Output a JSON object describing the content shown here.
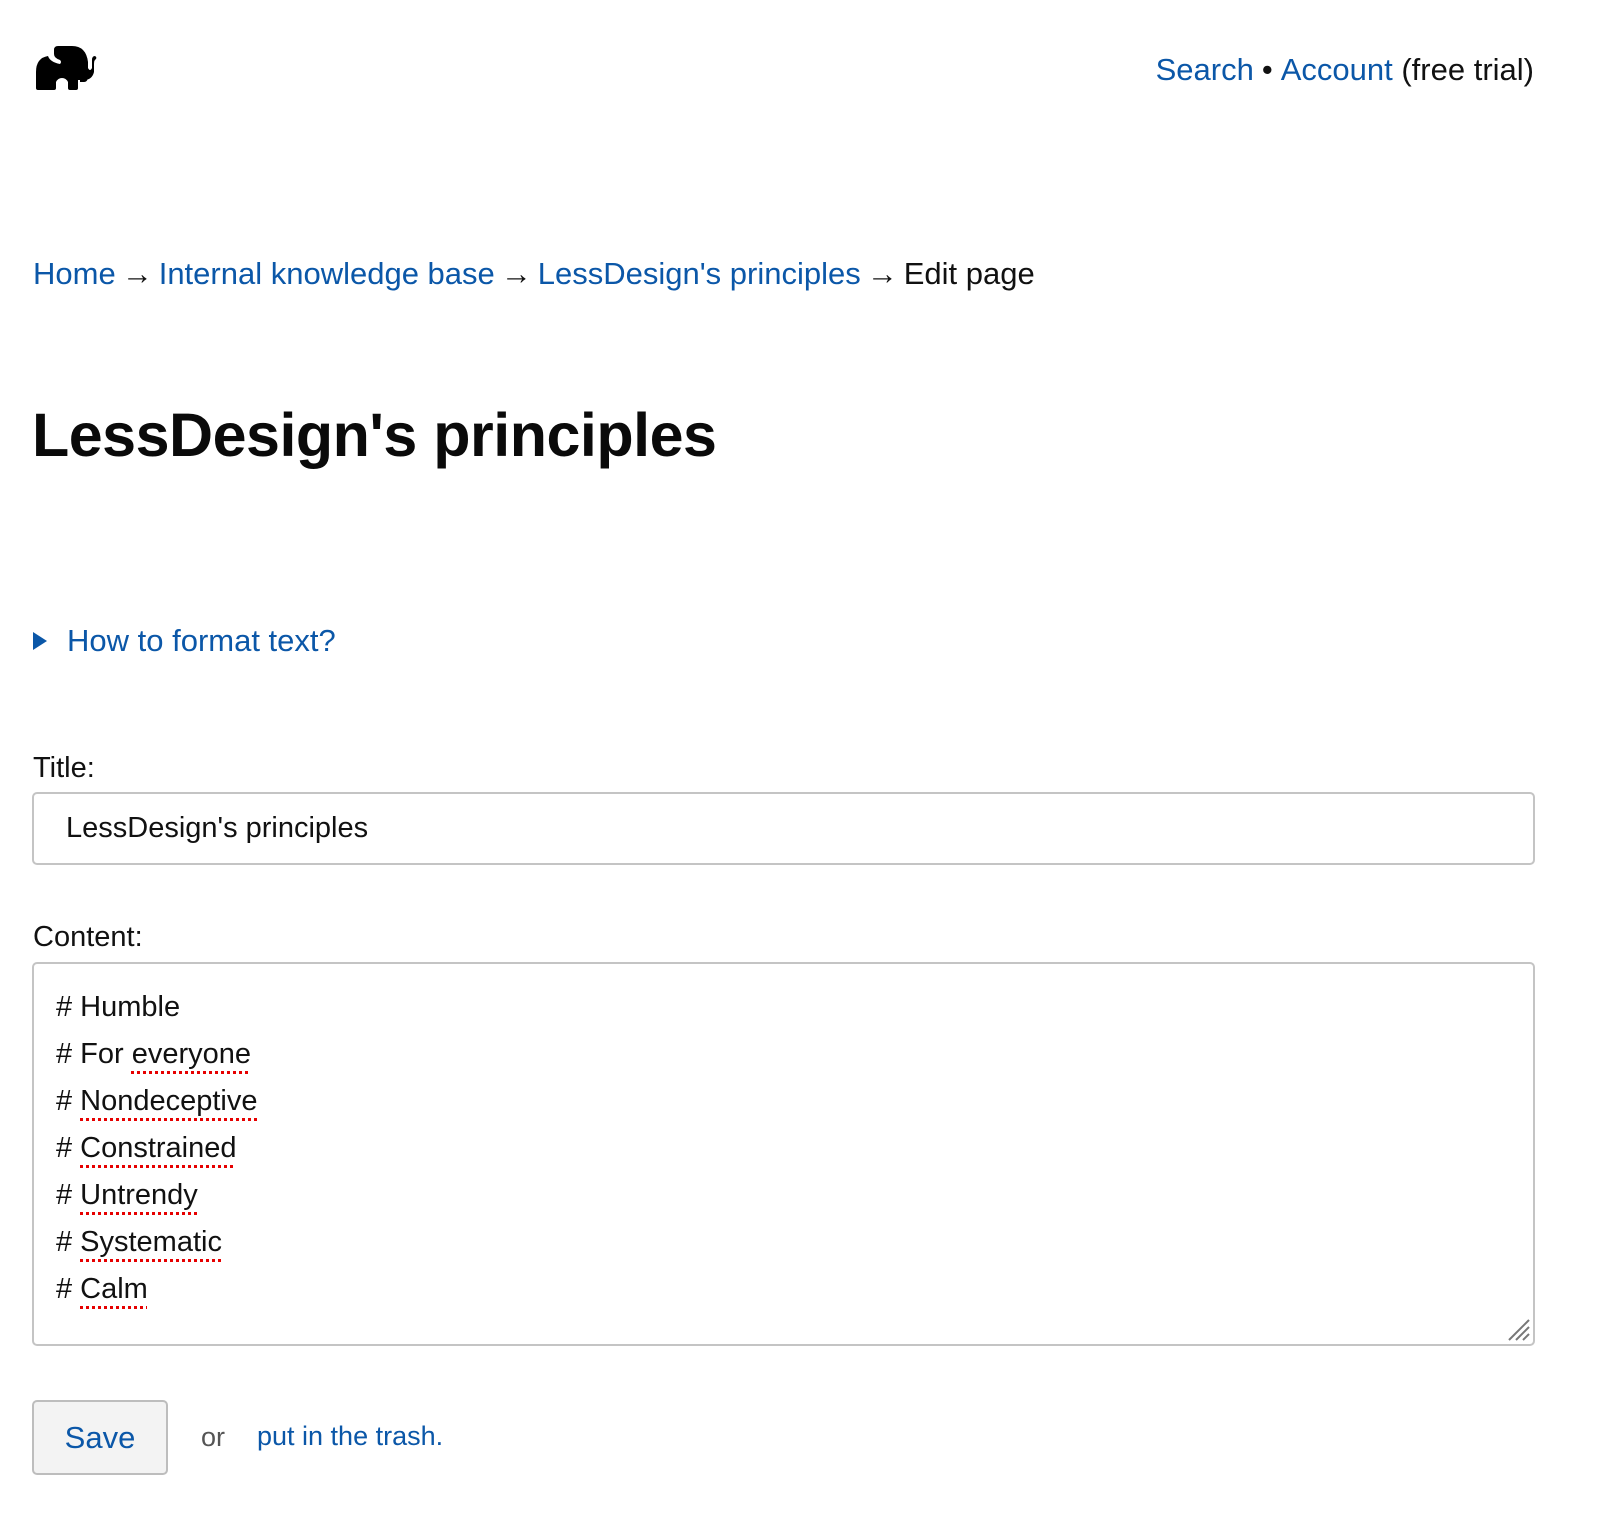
{
  "header": {
    "logo_icon": "elephant-icon",
    "nav": {
      "search_label": "Search",
      "separator": "•",
      "account_label": "Account",
      "account_note": "(free trial)"
    }
  },
  "breadcrumb": {
    "items": [
      {
        "label": "Home",
        "link": true
      },
      {
        "label": "Internal knowledge base",
        "link": true
      },
      {
        "label": "LessDesign's principles",
        "link": true
      },
      {
        "label": "Edit page",
        "link": false
      }
    ],
    "separator": "→"
  },
  "page": {
    "title": "LessDesign's principles",
    "format_help_label": "How to format text?"
  },
  "form": {
    "title_label": "Title:",
    "title_value": "LessDesign's principles",
    "content_label": "Content:",
    "content_lines": [
      {
        "hash": "#",
        "text": "Humble",
        "misspelled": false
      },
      {
        "hash": "#",
        "prefix": "For ",
        "text": "everyone",
        "misspelled": true
      },
      {
        "hash": "#",
        "text": "Nondeceptive",
        "misspelled": true
      },
      {
        "hash": "#",
        "text": "Constrained",
        "misspelled": true
      },
      {
        "hash": "#",
        "text": "Untrendy",
        "misspelled": true
      },
      {
        "hash": "#",
        "text": "Systematic",
        "misspelled": true
      },
      {
        "hash": "#",
        "text": "Calm",
        "misspelled": true
      }
    ],
    "save_label": "Save",
    "or_text": "or",
    "trash_label": "put in the trash."
  },
  "colors": {
    "link": "#0b57a8",
    "text": "#111111",
    "spellcheck": "#e60000",
    "border": "#c4c4c4",
    "button_bg": "#f3f3f3"
  }
}
